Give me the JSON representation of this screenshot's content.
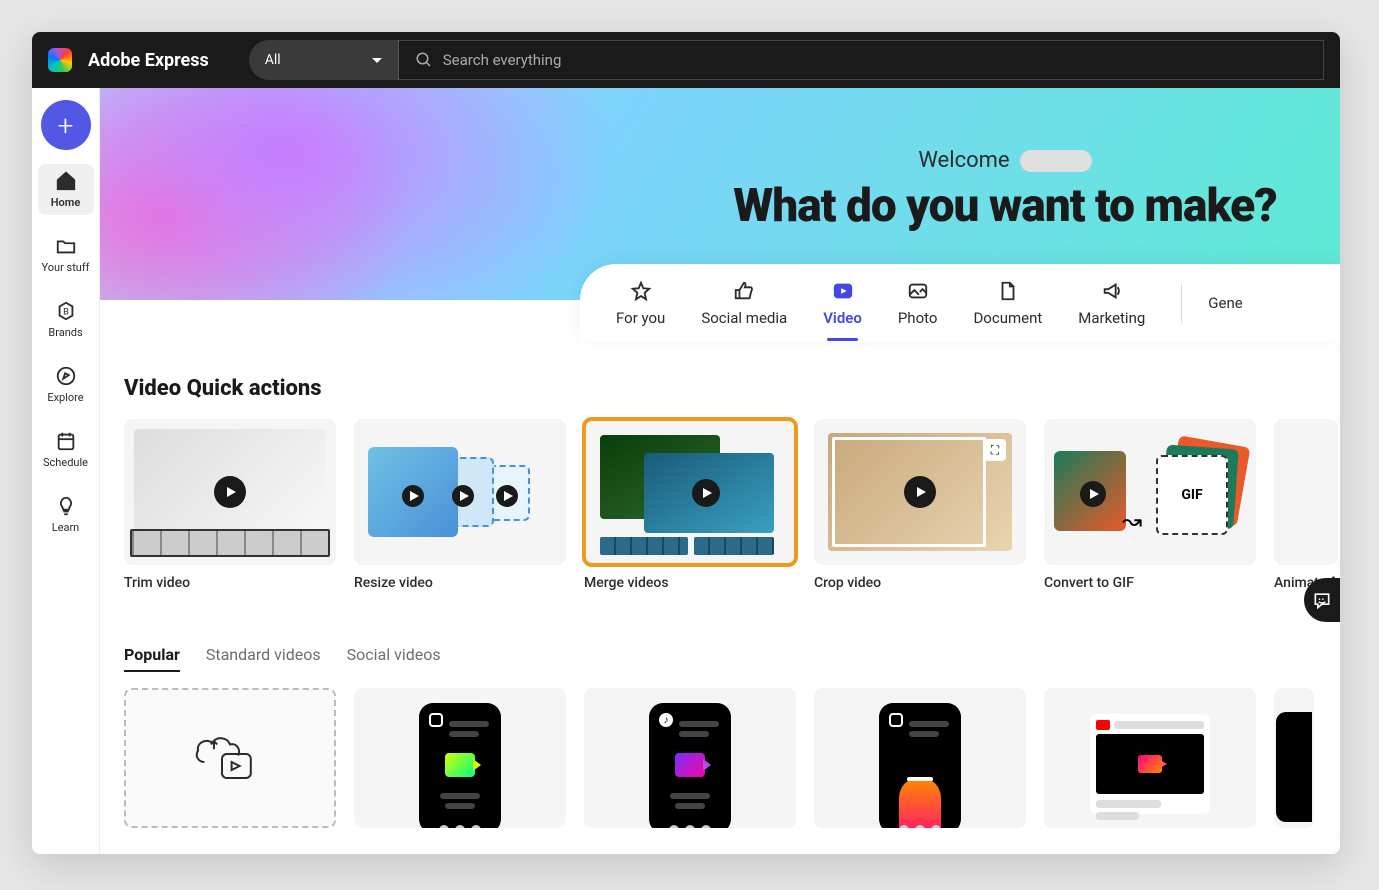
{
  "app": {
    "title": "Adobe Express"
  },
  "search": {
    "filter_label": "All",
    "placeholder": "Search everything"
  },
  "sidebar": {
    "items": [
      {
        "label": "Home"
      },
      {
        "label": "Your stuff"
      },
      {
        "label": "Brands"
      },
      {
        "label": "Explore"
      },
      {
        "label": "Schedule"
      },
      {
        "label": "Learn"
      }
    ]
  },
  "hero": {
    "welcome": "Welcome",
    "title": "What do you want to make?"
  },
  "tabs": [
    {
      "label": "For you"
    },
    {
      "label": "Social media"
    },
    {
      "label": "Video"
    },
    {
      "label": "Photo"
    },
    {
      "label": "Document"
    },
    {
      "label": "Marketing"
    },
    {
      "label": "Gene"
    }
  ],
  "section": {
    "title": "Video Quick actions"
  },
  "quick_actions": [
    {
      "label": "Trim video"
    },
    {
      "label": "Resize video"
    },
    {
      "label": "Merge videos"
    },
    {
      "label": "Crop video"
    },
    {
      "label": "Convert to GIF"
    },
    {
      "label": "Animate fro"
    }
  ],
  "gif_badge": "GIF",
  "template_tabs": [
    {
      "label": "Popular"
    },
    {
      "label": "Standard videos"
    },
    {
      "label": "Social videos"
    }
  ]
}
